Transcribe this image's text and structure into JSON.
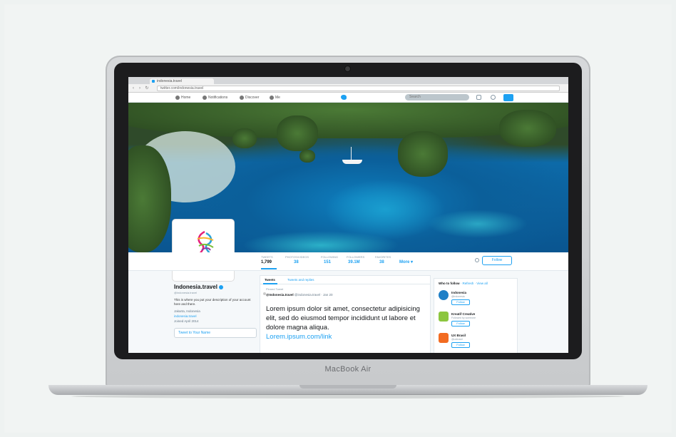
{
  "laptop": {
    "brand": "MacBook Air"
  },
  "browser": {
    "tab_title": "indonesia.travel",
    "url": "twitter.com/indonesia.travel"
  },
  "twitter_nav": {
    "items": [
      {
        "label": "Home",
        "icon": "home-icon"
      },
      {
        "label": "Notifications",
        "icon": "bell-icon"
      },
      {
        "label": "Discover",
        "icon": "hashtag-icon"
      },
      {
        "label": "Me",
        "icon": "user-icon"
      }
    ],
    "search_placeholder": "Search"
  },
  "profile": {
    "logo_tagline": "wonderful",
    "logo_name": "indonesia",
    "name": "Indonesia.travel",
    "handle": "@indonesia.travel",
    "bio": "This is where you put your description of your account here and there.",
    "location": "Jakarta, Indonesia",
    "website": "indonesia.travel",
    "joined": "Joined April 2014",
    "tweet_to_label": "Tweet to Your Name"
  },
  "stats": [
    {
      "label": "TWEETS",
      "value": "1,799"
    },
    {
      "label": "PHOTOS/VIDEOS",
      "value": "38"
    },
    {
      "label": "FOLLOWING",
      "value": "151"
    },
    {
      "label": "FOLLOWERS",
      "value": "39.1M"
    },
    {
      "label": "FAVORITES",
      "value": "38"
    }
  ],
  "more_label": "More ▾",
  "follow_label": "Follow",
  "timeline": {
    "tab_tweets": "Tweets",
    "tab_replies": "Tweets and replies",
    "pinned": "Pinned Tweet",
    "author_name": "@Indonesia.travel",
    "author_meta": "@indonesia.travel · Jan 20",
    "tweet_text": "Lorem ipsum dolor sit amet, consectetur adipisicing elit, sed do eiusmod tempor incididunt ut labore et dolore magna aliqua.",
    "tweet_link": "Lorem.ipsum.com/link"
  },
  "who_to_follow": {
    "title": "Who to follow",
    "refresh": "· Refresh · View all",
    "items": [
      {
        "name": "Indonesia",
        "sub": "@indonesia",
        "btn": "Follow",
        "color": "#1e7fc6"
      },
      {
        "name": "Kreatif Creative",
        "sub": "Followed by someone",
        "btn": "Follow",
        "color": "#8cc63f"
      },
      {
        "name": "UX Brasil",
        "sub": "@uxbrasil",
        "btn": "Follow",
        "color": "#f26b21"
      }
    ]
  }
}
